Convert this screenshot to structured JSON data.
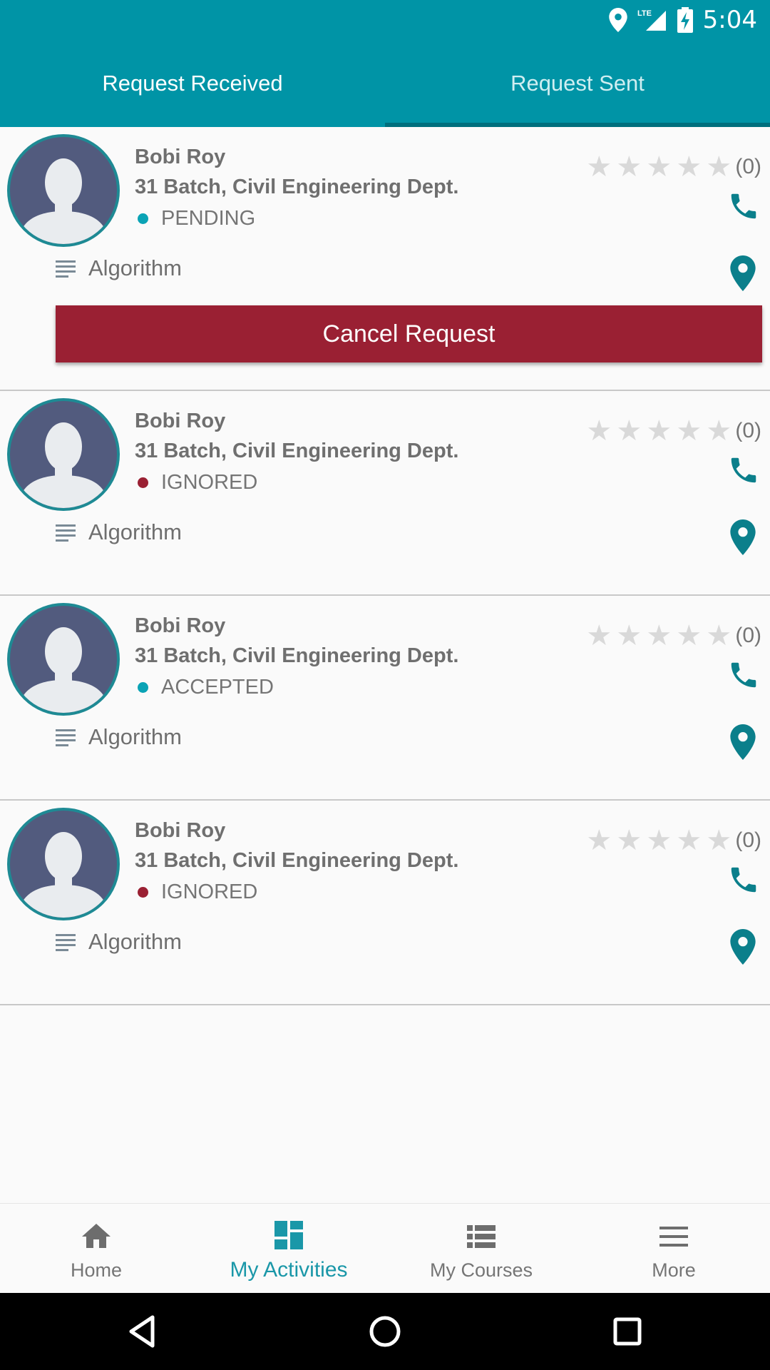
{
  "status_bar": {
    "time": "5:04",
    "network": "LTE",
    "icons": [
      "location-icon",
      "signal-icon",
      "battery-charging-icon"
    ]
  },
  "tabs": [
    {
      "label": "Request Received",
      "selected": true
    },
    {
      "label": "Request Sent",
      "selected": false
    }
  ],
  "requests": [
    {
      "name": "Bobi Roy",
      "department": "31 Batch, Civil Engineering Dept.",
      "status": "PENDING",
      "status_color": "#0aa3b5",
      "rating_count": "(0)",
      "stars": 0,
      "subject": "Algorithm",
      "action": "Cancel Request"
    },
    {
      "name": "Bobi Roy",
      "department": "31 Batch, Civil Engineering Dept.",
      "status": "IGNORED",
      "status_color": "#9a2033",
      "rating_count": "(0)",
      "stars": 0,
      "subject": "Algorithm"
    },
    {
      "name": "Bobi Roy",
      "department": "31 Batch, Civil Engineering Dept.",
      "status": "ACCEPTED",
      "status_color": "#0aa3b5",
      "rating_count": "(0)",
      "stars": 0,
      "subject": "Algorithm"
    },
    {
      "name": "Bobi Roy",
      "department": "31 Batch, Civil Engineering Dept.",
      "status": "IGNORED",
      "status_color": "#9a2033",
      "rating_count": "(0)",
      "stars": 0,
      "subject": "Algorithm"
    }
  ],
  "bottom_nav": [
    {
      "label": "Home",
      "icon": "home-icon",
      "active": false
    },
    {
      "label": "My Activities",
      "icon": "dashboard-icon",
      "active": true
    },
    {
      "label": "My Courses",
      "icon": "list-icon",
      "active": false
    },
    {
      "label": "More",
      "icon": "menu-icon",
      "active": false
    }
  ],
  "colors": {
    "primary": "#0094a6",
    "accent_dark": "#006f7d",
    "danger": "#9a2033",
    "icon_teal": "#0b7f8b"
  }
}
